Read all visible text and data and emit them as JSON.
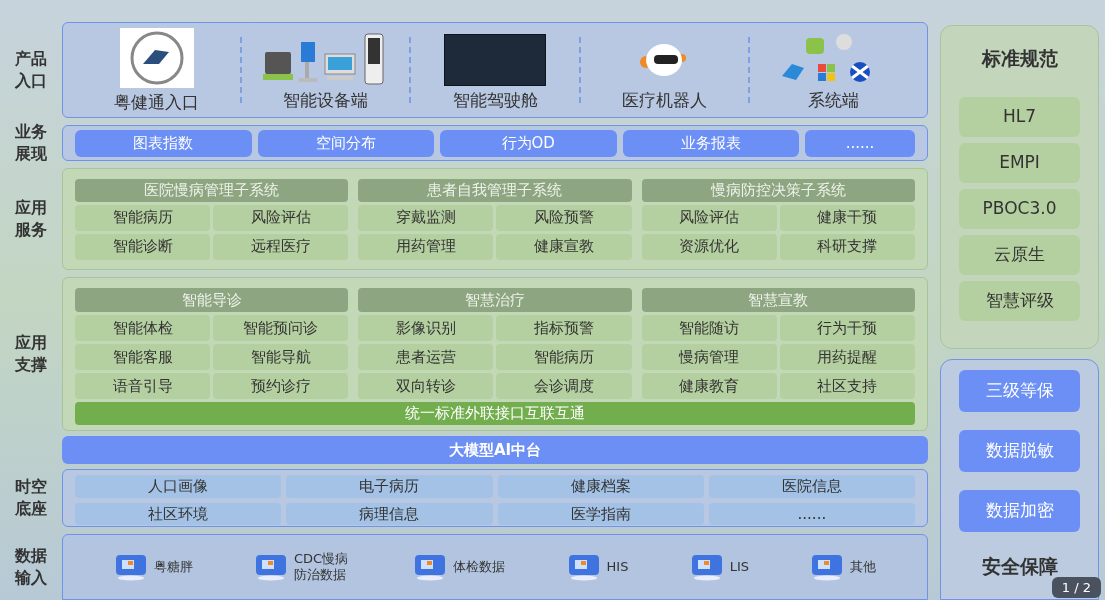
{
  "row_labels": {
    "product": "产品入口",
    "business": "业务展现",
    "services": "应用服务",
    "support": "应用支撑",
    "spacetime": "时空底座",
    "input": "数据输入"
  },
  "product_entry": [
    {
      "kind": "logo",
      "label": "粤健通入口"
    },
    {
      "kind": "devices",
      "label": "智能设备端"
    },
    {
      "kind": "dashboard",
      "label": "智能驾驶舱"
    },
    {
      "kind": "robot",
      "label": "医疗机器人"
    },
    {
      "kind": "os",
      "label": "系统端"
    }
  ],
  "business": [
    "图表指数",
    "空间分布",
    "行为OD",
    "业务报表",
    "......"
  ],
  "app_services": [
    {
      "title": "医院慢病管理子系统",
      "items": [
        "智能病历",
        "风险评估",
        "智能诊断",
        "远程医疗"
      ]
    },
    {
      "title": "患者自我管理子系统",
      "items": [
        "穿戴监测",
        "风险预警",
        "用药管理",
        "健康宣教"
      ]
    },
    {
      "title": "慢病防控决策子系统",
      "items": [
        "风险评估",
        "健康干预",
        "资源优化",
        "科研支撑"
      ]
    }
  ],
  "app_support": {
    "groups": [
      {
        "title": "智能导诊",
        "items": [
          "智能体检",
          "智能预问诊",
          "智能客服",
          "智能导航",
          "语音引导",
          "预约诊疗"
        ]
      },
      {
        "title": "智慧治疗",
        "items": [
          "影像识别",
          "指标预警",
          "患者运营",
          "智能病历",
          "双向转诊",
          "会诊调度"
        ]
      },
      {
        "title": "智慧宣教",
        "items": [
          "智能随访",
          "行为干预",
          "慢病管理",
          "用药提醒",
          "健康教育",
          "社区支持"
        ]
      }
    ],
    "bar": "统一标准外联接口互联互通"
  },
  "ai_platform": "大模型AI中台",
  "spacetime": [
    "人口画像",
    "电子病历",
    "健康档案",
    "医院信息",
    "社区环境",
    "病理信息",
    "医学指南",
    "......"
  ],
  "data_input": [
    "粤糖胖",
    "CDC慢病防治数据",
    "体检数据",
    "HIS",
    "LIS",
    "其他"
  ],
  "standards": {
    "title": "标准规范",
    "items": [
      "HL7",
      "EMPI",
      "PBOC3.0",
      "云原生",
      "智慧评级"
    ]
  },
  "security": {
    "items": [
      "三级等保",
      "数据脱敏",
      "数据加密"
    ],
    "title": "安全保障"
  },
  "pager": "1 / 2"
}
